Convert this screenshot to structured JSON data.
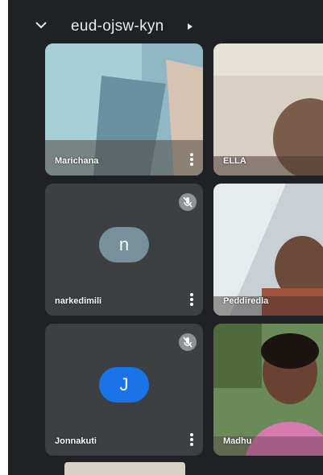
{
  "meeting": {
    "code": "eud-ojsw-kyn"
  },
  "participants": [
    {
      "name": "Marichana",
      "avatar": ""
    },
    {
      "name": "ELLA",
      "avatar": ""
    },
    {
      "name": "narkedimili",
      "avatar": "n",
      "avatar_color": "#78909c",
      "muted": true
    },
    {
      "name": "Peddiredla",
      "avatar": ""
    },
    {
      "name": "Jonnakuti",
      "avatar": "J",
      "avatar_color": "#1a73e8",
      "muted": true
    },
    {
      "name": "Madhu",
      "avatar": ""
    }
  ],
  "colors": {
    "background": "#202124",
    "tile": "#3c4043",
    "text": "#e8eaed",
    "accent_blue": "#1a73e8"
  }
}
